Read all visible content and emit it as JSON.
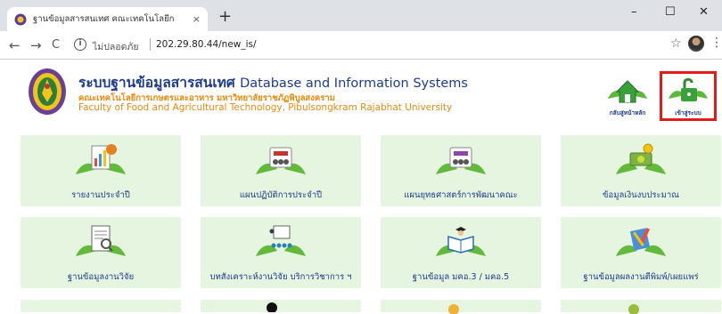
{
  "browser": {
    "tab_title": "ฐานข้อมูลสารสนเทศ คณะเทคโนโลยีก",
    "tab_close": "×",
    "new_tab": "+",
    "window_controls": [
      "–",
      "☐",
      "✕"
    ],
    "nav": {
      "back": "←",
      "forward": "→",
      "reload": "C"
    },
    "security_label": "ไม่ปลอดภัย",
    "url": "202.29.80.44/new_is/",
    "star": "☆",
    "menu": "⋮",
    "icons": [
      "tab-favicon-icon",
      "info-icon",
      "star-icon",
      "profile-avatar",
      "kebab-menu-icon"
    ]
  },
  "header": {
    "title_th": "ระบบฐานข้อมูลสารสนเทศ",
    "title_en": "Database and Information Systems",
    "subtitle_th": "คณะเทคโนโลยีการเกษตรและอาหาร มหาวิทยาลัยราชภัฏพิบูลสงคราม",
    "subtitle_en": "Faculty of Food and Agricultural Technology, Pibulsongkram Rajabhat University",
    "home_label": "กลับสู่หน้าหลัก",
    "login_label": "เข้าสู่ระบบ",
    "colors": {
      "title": "#1d3c8c",
      "subtitle": "#e58a11",
      "highlight": "#e21b1b",
      "card_bg": "#e5f5df"
    }
  },
  "menu": {
    "row1": [
      {
        "label": "รายงานประจำปี",
        "icon": "report-chart-icon"
      },
      {
        "label": "แผนปฏิบัติการประจำปี",
        "icon": "plan-people-icon"
      },
      {
        "label": "แผนยุทธศาสตร์การพัฒนาคณะ",
        "icon": "strategy-plan-icon"
      },
      {
        "label": "ข้อมูลเงินงบประมาณ",
        "icon": "budget-money-icon"
      }
    ],
    "row2": [
      {
        "label": "ฐานข้อมูลงานวิจัย",
        "icon": "research-doc-icon"
      },
      {
        "label": "บทสังเคราะห์งานวิจัย บริการวิชาการ ฯ",
        "icon": "presentation-icon"
      },
      {
        "label": "ฐานข้อมูล มคอ.3 / มคอ.5",
        "icon": "book-graduate-icon"
      },
      {
        "label": "ฐานข้อมูลผลงานตีพิมพ์/เผยแพร่",
        "icon": "publication-tools-icon"
      }
    ]
  }
}
